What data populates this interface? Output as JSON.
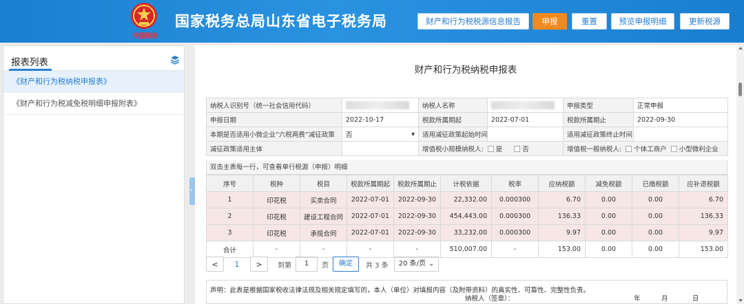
{
  "header": {
    "emblem_text": "中国税务",
    "title": "国家税务总局山东省电子税务局",
    "buttons": {
      "report_info": "财产和行为税税源信息报告",
      "declare": "申报",
      "reset": "重置",
      "preview": "预览申报明细",
      "update_source": "更新税源"
    }
  },
  "sidebar": {
    "title": "报表列表",
    "items": [
      "《财产和行为税纳税申报表》",
      "《财产和行为税减免税明细申报附表》"
    ]
  },
  "form": {
    "title": "财产和行为税纳税申报表",
    "info": {
      "taxpayer_id_label": "纳税人识别号（统一社会信用代码）",
      "taxpayer_name_label": "纳税人名称",
      "declare_type_label": "申报类型",
      "declare_type_value": "正常申报",
      "declare_date_label": "申报日期",
      "declare_date_value": "2022-10-17",
      "period_start_label": "税款所属期起",
      "period_start_value": "2022-07-01",
      "period_end_label": "税款所属期止",
      "period_end_value": "2022-09-30",
      "small_policy_label": "本期是否适用小微企业“六税两费”减征政策",
      "small_policy_value": "否",
      "reduce_start_label": "适用减征政策起始时间",
      "reduce_end_label": "适用减征政策终止时间",
      "reduce_subject_label": "减征政策适用主体",
      "vat_small_label": "增值税小规模纳税人:",
      "yes_label": "是",
      "no_label": "否",
      "vat_general_label": "增值税一般纳税人:",
      "individual_label": "个体工商户",
      "micro_label": "小型微利企业"
    },
    "hint": "双击主表每一行，可查看单行税源（申报）明细",
    "columns": [
      "序号",
      "税种",
      "税目",
      "税款所属期起",
      "税款所属期止",
      "计税依据",
      "税率",
      "应纳税额",
      "减免税额",
      "已缴税额",
      "应补退税额"
    ],
    "rows": [
      [
        "1",
        "印花税",
        "买卖合同",
        "2022-07-01",
        "2022-09-30",
        "22,332.00",
        "0.000300",
        "6.70",
        "0.00",
        "0.00",
        "6.70"
      ],
      [
        "2",
        "印花税",
        "建设工程合同",
        "2022-07-01",
        "2022-09-30",
        "454,443.00",
        "0.000300",
        "136.33",
        "0.00",
        "0.00",
        "136.33"
      ],
      [
        "3",
        "印花税",
        "承揽合同",
        "2022-07-01",
        "2022-09-30",
        "33,232.00",
        "0.000300",
        "9.97",
        "0.00",
        "0.00",
        "9.97"
      ]
    ],
    "total": [
      "合计",
      "-",
      "-",
      "-",
      "-",
      "510,007.00",
      "-",
      "153.00",
      "0.00",
      "0.00",
      "153.00"
    ]
  },
  "pager": {
    "prev": "<",
    "current": "1",
    "next": ">",
    "goto_label": "到第",
    "goto_value": "1",
    "page_unit": "页",
    "confirm": "确定",
    "total_text": "共 3 条",
    "page_size": "20 条/页"
  },
  "declaration": {
    "text": "声明：此表是根据国家税收法律法规及相关规定填写的，本人（单位）对填报内容（及附带资料）的真实性、可靠性、完整性负责。",
    "signer": "纳税人（签章）：",
    "year": "年",
    "month": "月",
    "day": "日"
  }
}
